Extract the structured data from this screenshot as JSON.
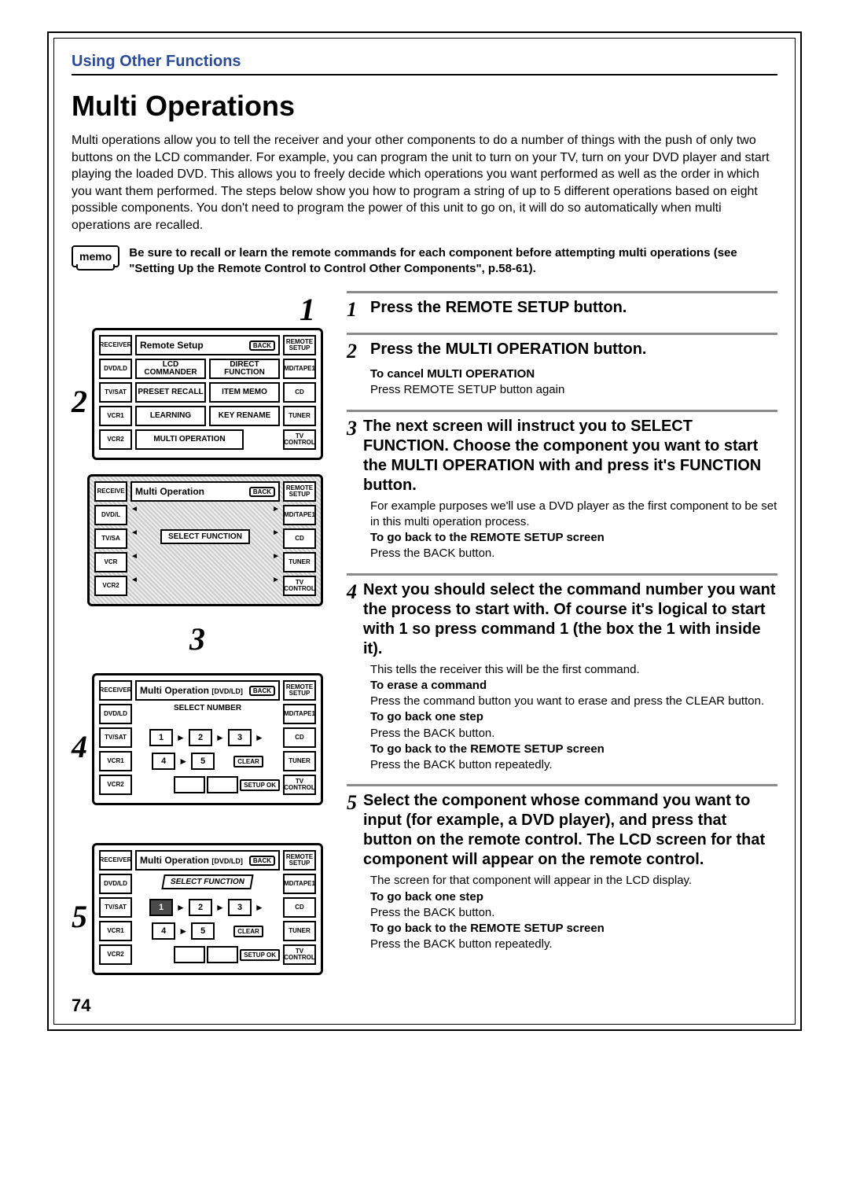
{
  "header": "Using Other Functions",
  "title": "Multi Operations",
  "intro": "Multi operations allow you to tell the receiver and your other components to do a number of things with the push of only two buttons on the LCD commander. For example, you can program the unit to turn on your TV, turn on your DVD player and start playing the loaded DVD. This allows you to freely decide which operations you want performed as well as the order in which you want them performed. The steps below show you how to program a string of up to 5 different operations based on eight possible components. You don't need to program the power of this unit to go on, it will do so automatically when multi operations are recalled.",
  "memo": {
    "label": "memo",
    "text": "Be sure to recall or learn the remote commands for each component before attempting multi operations (see \"Setting Up the Remote Control to Control Other Components\", p.58-61)."
  },
  "page_number": "74",
  "big_nums": {
    "n1": "1",
    "n2": "2",
    "n3": "3",
    "n4": "4",
    "n5": "5"
  },
  "lcd1": {
    "title": "Remote Setup",
    "back": "BACK",
    "side_right_top": "REMOTE SETUP",
    "left": [
      "RECEIVER",
      "DVD/LD",
      "TV/SAT",
      "VCR1",
      "VCR2"
    ],
    "right": [
      "MD/TAPE1",
      "CD",
      "TUNER",
      "TV CONTROL"
    ],
    "buttons": {
      "b1": "LCD COMMANDER",
      "b2": "DIRECT FUNCTION",
      "b3": "PRESET RECALL",
      "b4": "ITEM MEMO",
      "b5": "LEARNING",
      "b6": "KEY RENAME",
      "b7": "MULTI OPERATION"
    }
  },
  "lcd2": {
    "title": "Multi Operation",
    "back": "BACK",
    "banner": "SELECT FUNCTION",
    "left": [
      "RECEIVE",
      "DVD/L",
      "TV/SA",
      "VCR",
      "VCR2"
    ],
    "right": [
      "REMOTE SETUP",
      "MD/TAPE1",
      "CD",
      "TUNER",
      "TV CONTROL"
    ]
  },
  "lcd3": {
    "title": "Multi Operation",
    "sub": "[DVD/LD]",
    "back": "BACK",
    "banner": "SELECT NUMBER",
    "left": [
      "RECEIVER",
      "DVD/LD",
      "TV/SAT",
      "VCR1",
      "VCR2"
    ],
    "right": [
      "REMOTE SETUP",
      "MD/TAPE1",
      "CD",
      "TUNER",
      "TV CONTROL"
    ],
    "nums": [
      "1",
      "2",
      "3",
      "4",
      "5"
    ],
    "clear": "CLEAR",
    "setup_ok": "SETUP OK"
  },
  "lcd4": {
    "title": "Multi Operation",
    "sub": "[DVD/LD]",
    "back": "BACK",
    "banner": "SELECT FUNCTION",
    "left": [
      "RECEIVER",
      "DVD/LD",
      "TV/SAT",
      "VCR1",
      "VCR2"
    ],
    "right": [
      "REMOTE SETUP",
      "MD/TAPE1",
      "CD",
      "TUNER",
      "TV CONTROL"
    ],
    "nums": [
      "1",
      "2",
      "3",
      "4",
      "5"
    ],
    "clear": "CLEAR",
    "setup_ok": "SETUP OK"
  },
  "steps": {
    "s1": {
      "num": "1",
      "title": "Press the REMOTE SETUP button."
    },
    "s2": {
      "num": "2",
      "title": "Press the MULTI OPERATION button.",
      "b1": "To cancel MULTI OPERATION",
      "t1": "Press REMOTE SETUP button again"
    },
    "s3": {
      "num": "3",
      "title": "The next screen will instruct you to SELECT FUNCTION. Choose the component you want to start the MULTI OPERATION with and press it's FUNCTION button.",
      "t1": "For example purposes we'll use a DVD player as the first component to be set in this multi operation process.",
      "b1": "To go back to the REMOTE SETUP screen",
      "t2": "Press the BACK button."
    },
    "s4": {
      "num": "4",
      "title": "Next you should select the command number you want the process to start with. Of course it's logical to start with 1 so press command 1 (the box the 1 with inside it).",
      "t1": "This tells the receiver this will be the first command.",
      "b1": "To erase a command",
      "t2": "Press the command button you want to erase and press the CLEAR button.",
      "b2": "To go back one step",
      "t3": "Press the BACK button.",
      "b3": "To go back to the REMOTE SETUP screen",
      "t4": "Press the BACK button repeatedly."
    },
    "s5": {
      "num": "5",
      "title": "Select the component whose command you want to input (for example, a DVD player), and press that button on the remote control. The LCD screen for that component will appear on the remote control.",
      "t1": "The screen for that component will appear in the LCD display.",
      "b1": "To go back one step",
      "t2": "Press the BACK button.",
      "b2": "To go back to the REMOTE SETUP screen",
      "t3": "Press the BACK button repeatedly."
    }
  }
}
